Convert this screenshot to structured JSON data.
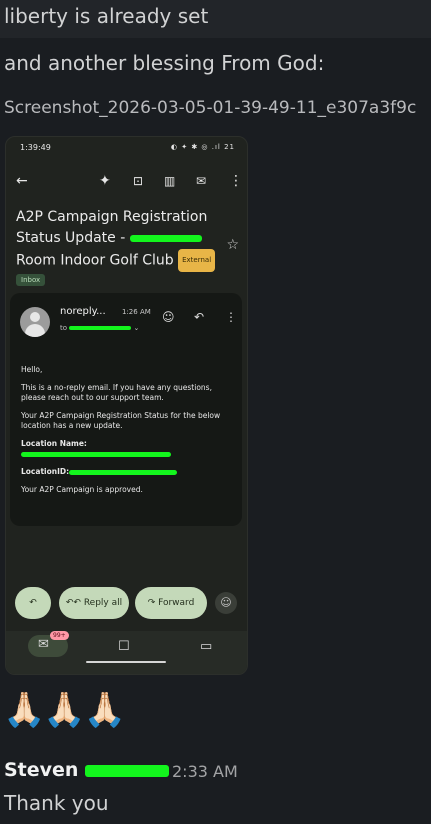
{
  "chat": {
    "line1": "liberty is already set",
    "line2": "and another blessing From God:",
    "attachment_name": "Screenshot_2026-03-05-01-39-49-11_e307a3f9c",
    "reaction_emojis": "🙏🏻🙏🏻🙏🏻",
    "author": "Steven",
    "timestamp": "2:33 AM",
    "message": "Thank you"
  },
  "phone": {
    "time": "1:39:49",
    "status_icons": "◐ ✦ ✱ ◎ .ıl 21",
    "subject_line1": "A2P Campaign Registration",
    "subject_line2": "Status Update -",
    "subject_line3": "Room Indoor Golf Club",
    "external_label": "External",
    "inbox_label": "Inbox",
    "sender": "noreply...",
    "sent_time": "1:26 AM",
    "to_label": "to",
    "body": {
      "greeting": "Hello,",
      "para1": "This is a no-reply email. If you have any questions, please reach out to our support team.",
      "para2": "Your A2P Campaign Registration Status for the below location has a new update.",
      "location_name_label": "Location Name:",
      "location_id_label": "LocationID:",
      "para3": "Your A2P Campaign is approved."
    },
    "reply_all_label": "Reply all",
    "forward_label": "Forward",
    "mail_badge": "99+"
  }
}
